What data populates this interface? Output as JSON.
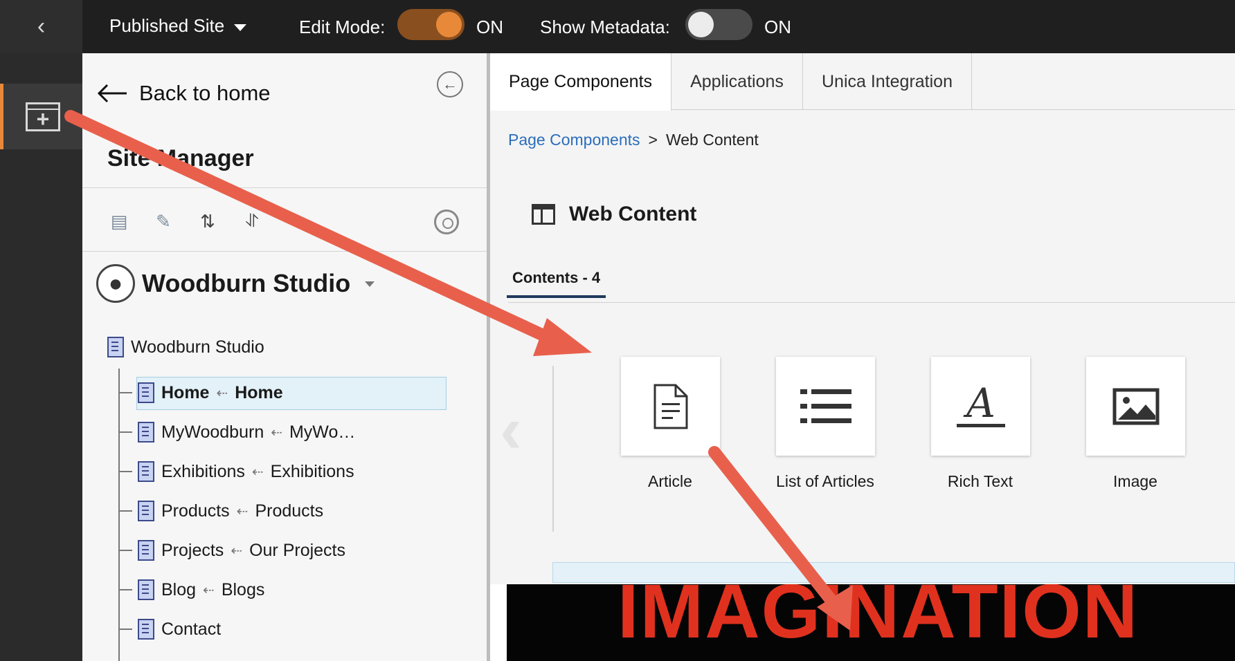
{
  "topbar": {
    "site_selector": "Published Site",
    "edit_mode_label": "Edit Mode:",
    "edit_mode_state": "ON",
    "show_metadata_label": "Show Metadata:",
    "show_metadata_state": "ON",
    "edit_mode_on_color": "#e8893a"
  },
  "site_manager": {
    "back_label": "Back to home",
    "title": "Site Manager",
    "site_name": "Woodburn Studio",
    "root_node": "Woodburn Studio",
    "nodes": [
      {
        "name": "Home",
        "target": "Home"
      },
      {
        "name": "MyWoodburn",
        "target": "MyWo…"
      },
      {
        "name": "Exhibitions",
        "target": "Exhibitions"
      },
      {
        "name": "Products",
        "target": "Products"
      },
      {
        "name": "Projects",
        "target": "Our Projects"
      },
      {
        "name": "Blog",
        "target": "Blogs"
      },
      {
        "name": "Contact",
        "target": ""
      }
    ]
  },
  "panel": {
    "tabs": [
      "Page Components",
      "Applications",
      "Unica Integration"
    ],
    "breadcrumb_link": "Page Components",
    "breadcrumb_sep": ">",
    "breadcrumb_current": "Web Content",
    "section_title": "Web Content",
    "subtab": "Contents - 4",
    "items": [
      "Article",
      "List of Articles",
      "Rich Text",
      "Image"
    ]
  },
  "preview": {
    "headline": "IMAGINATION"
  },
  "annotation_color": "#e8604c"
}
